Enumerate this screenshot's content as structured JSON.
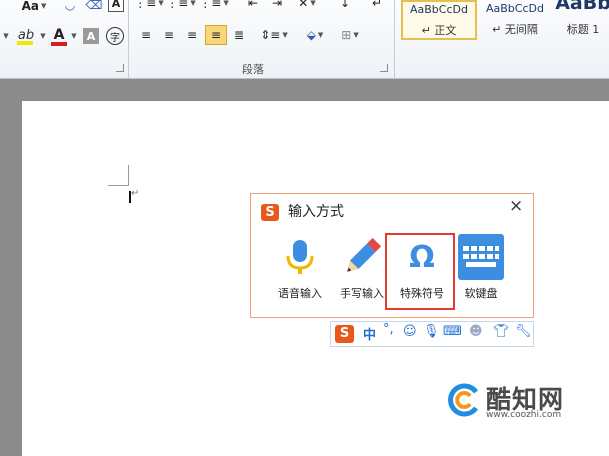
{
  "ribbon": {
    "font_size_btn": "Aa",
    "paragraph_group_label": "段落",
    "styles": [
      {
        "sample": "AaBbCcDd",
        "name": "↵ 正文"
      },
      {
        "sample": "AaBbCcDd",
        "name": "↵ 无间隔"
      },
      {
        "sample": "AaBb",
        "name": "标题 1"
      }
    ],
    "text_color_hex": "#d21f1f",
    "highlight_color_hex": "#f3e600"
  },
  "document": {
    "paragraph_mark": "↵"
  },
  "ime_panel": {
    "logo": "S",
    "title": "输入方式",
    "close": "×",
    "options": [
      {
        "label": "语音输入",
        "icon": "microphone-icon"
      },
      {
        "label": "手写输入",
        "icon": "pencil-icon"
      },
      {
        "label": "特殊符号",
        "icon": "omega-icon"
      },
      {
        "label": "软键盘",
        "icon": "keyboard-icon"
      }
    ]
  },
  "ime_toolbar": {
    "logo": "S",
    "mode": "中",
    "punct": "°,",
    "items": [
      "emoji-icon",
      "microphone-icon",
      "keyboard-icon",
      "user-icon",
      "shirt-icon",
      "wrench-icon"
    ]
  },
  "watermark": {
    "name": "酷知网",
    "url": "www.coozhi.com"
  }
}
